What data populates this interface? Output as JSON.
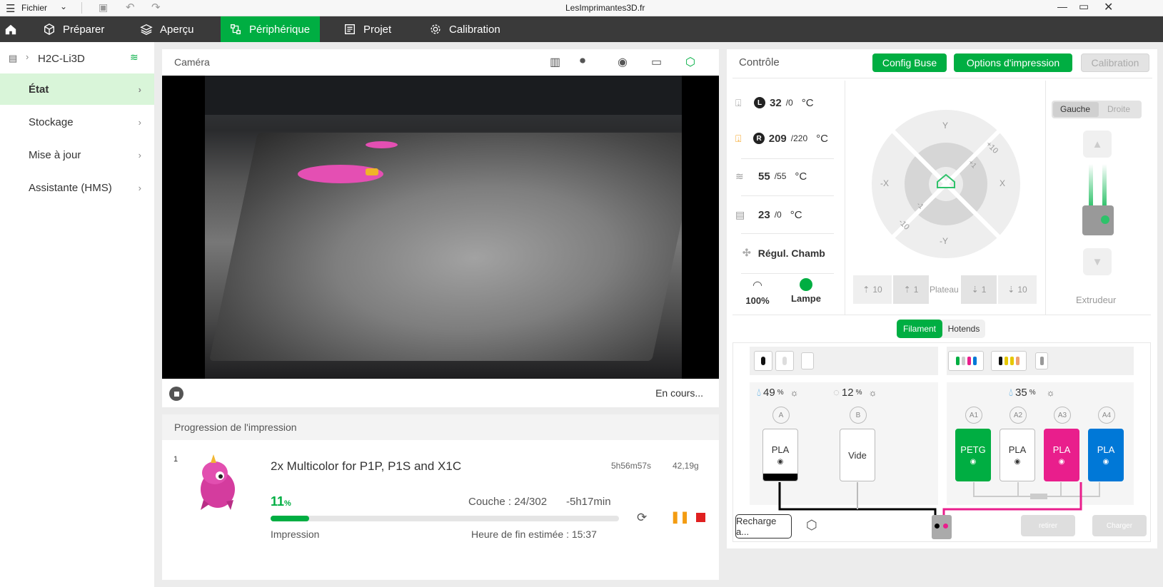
{
  "titlebar": {
    "menu_label": "Fichier",
    "app_title": "LesImprimantes3D.fr"
  },
  "nav": {
    "tabs": [
      {
        "label": "Préparer"
      },
      {
        "label": "Aperçu"
      },
      {
        "label": "Périphérique"
      },
      {
        "label": "Projet"
      },
      {
        "label": "Calibration"
      }
    ],
    "active_tab": "Périphérique",
    "accent": "#00ae42"
  },
  "sidebar": {
    "printer_name": "H2C-Li3D",
    "items": [
      {
        "label": "État"
      },
      {
        "label": "Stockage"
      },
      {
        "label": "Mise à jour"
      },
      {
        "label": "Assistante (HMS)"
      }
    ]
  },
  "camera": {
    "title": "Caméra",
    "status": "En cours..."
  },
  "progress": {
    "title": "Progression de l'impression",
    "index": "1",
    "job_name": "2x Multicolor for P1P, P1S and X1C",
    "duration": "5h56m57s",
    "weight": "42,19g",
    "percent_value": "11",
    "percent_sign": "%",
    "progress": 0.11,
    "layer": "Couche : 24/302",
    "remaining": "-5h17min",
    "state": "Impression",
    "end_time": "Heure de fin estimée : 15:37"
  },
  "control": {
    "title": "Contrôle",
    "config_buse": "Config Buse",
    "print_options": "Options d'impression",
    "calibration": "Calibration",
    "temps": [
      {
        "badge": "L",
        "current": "32",
        "target": "/0",
        "unit": "°C"
      },
      {
        "badge": "R",
        "current": "209",
        "target": "/220",
        "unit": "°C"
      },
      {
        "current": "55",
        "target": "/55",
        "unit": "°C"
      },
      {
        "current": "23",
        "target": "/0",
        "unit": "°C"
      }
    ],
    "chamber": "Régul. Chamb",
    "speed": "100%",
    "lamp": "Lampe",
    "jog": {
      "y": "Y",
      "minus_y": "-Y",
      "x": "X",
      "minus_x": "-X",
      "p10": "+10",
      "p1": "+1",
      "m1": "-1",
      "m10": "-10"
    },
    "bed": {
      "label": "Plateau",
      "up10": "10",
      "up1": "1",
      "down1": "1",
      "down10": "10"
    },
    "extruder": {
      "left": "Gauche",
      "right": "Droite",
      "label": "Extrudeur"
    }
  },
  "filament": {
    "tab_filament": "Filament",
    "tab_hotends": "Hotends",
    "left_unit": {
      "slots": [
        {
          "letter": "A",
          "humidity": "49",
          "type": "PLA",
          "color": "#000000"
        },
        {
          "letter": "B",
          "humidity": "12",
          "type": "Vide",
          "color": "#ffffff"
        }
      ]
    },
    "right_unit": {
      "humidity": "35",
      "slots": [
        {
          "letter": "A1",
          "type": "PETG",
          "color": "#00ae42"
        },
        {
          "letter": "A2",
          "type": "PLA",
          "color": "#ffffff"
        },
        {
          "letter": "A3",
          "type": "PLA",
          "color": "#e91e8c"
        },
        {
          "letter": "A4",
          "type": "PLA",
          "color": "#0078d7"
        }
      ]
    },
    "recharge": "Recharge a...",
    "retirer": "retirer",
    "charger": "Charger",
    "percent_sign": "%"
  }
}
